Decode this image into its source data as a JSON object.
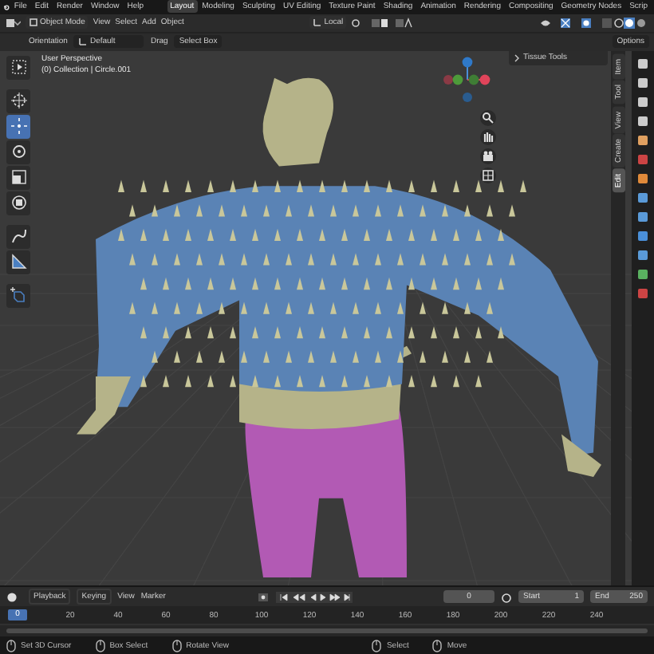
{
  "top_menu": {
    "items": [
      "File",
      "Edit",
      "Render",
      "Window",
      "Help"
    ]
  },
  "workspace_tabs": [
    {
      "label": "Layout",
      "selected": true
    },
    {
      "label": "Modeling",
      "selected": false
    },
    {
      "label": "Sculpting",
      "selected": false
    },
    {
      "label": "UV Editing",
      "selected": false
    },
    {
      "label": "Texture Paint",
      "selected": false
    },
    {
      "label": "Shading",
      "selected": false
    },
    {
      "label": "Animation",
      "selected": false
    },
    {
      "label": "Rendering",
      "selected": false
    },
    {
      "label": "Compositing",
      "selected": false
    },
    {
      "label": "Geometry Nodes",
      "selected": false
    },
    {
      "label": "Scrip",
      "selected": false
    }
  ],
  "header": {
    "mode": "Object Mode",
    "menus": [
      "View",
      "Select",
      "Add",
      "Object"
    ],
    "transform_orientation": "Local"
  },
  "tool_settings": {
    "orientation_label": "Orientation",
    "orientation": "Default",
    "drag_label": "Drag",
    "drag": "Select Box",
    "options": "Options"
  },
  "viewport": {
    "view_name": "User Perspective",
    "collection": "(0) Collection | Circle.001",
    "toolbar": [
      {
        "kind": "select",
        "selected": false
      },
      {
        "kind": "cursor",
        "selected": false
      },
      {
        "kind": "move",
        "selected": true
      },
      {
        "kind": "rotate",
        "selected": false
      },
      {
        "kind": "scale",
        "selected": false
      },
      {
        "kind": "transform",
        "selected": false
      },
      {
        "kind": "annotate",
        "selected": false
      },
      {
        "kind": "measure",
        "selected": false
      },
      {
        "kind": "add",
        "selected": false
      }
    ],
    "n_panel": {
      "panel": "Tissue Tools",
      "tabs": [
        {
          "label": "Item",
          "selected": false
        },
        {
          "label": "Tool",
          "selected": false
        },
        {
          "label": "View",
          "selected": false
        },
        {
          "label": "Create",
          "selected": false
        },
        {
          "label": "Edit",
          "selected": true
        }
      ]
    }
  },
  "timeline": {
    "menus": [
      "Playback",
      "Keying",
      "View",
      "Marker"
    ],
    "current_frame": "0",
    "start_label": "Start",
    "start": "1",
    "end_label": "End",
    "end": "250",
    "playhead": "0",
    "ruler": [
      "20",
      "40",
      "60",
      "80",
      "100",
      "120",
      "140",
      "160",
      "180",
      "200",
      "220",
      "240"
    ]
  },
  "status_bar": [
    "Set 3D Cursor",
    "Box Select",
    "Rotate View",
    "Select",
    "Move"
  ]
}
